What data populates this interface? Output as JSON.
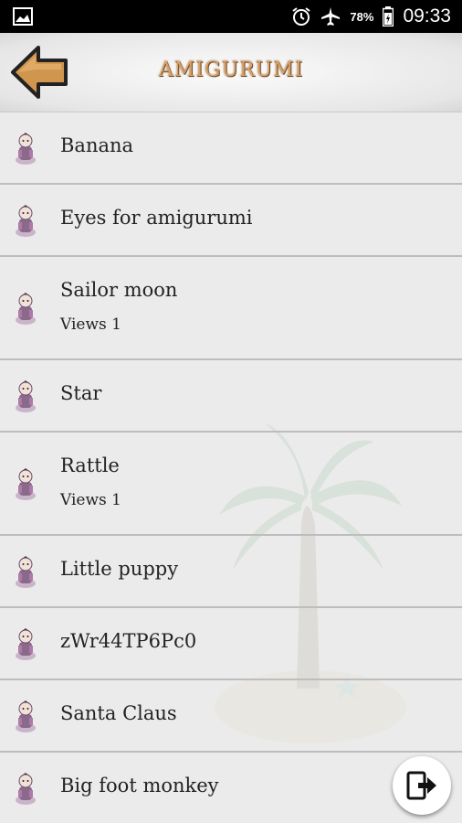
{
  "status_bar": {
    "battery": "78%",
    "time": "09:33",
    "icons": [
      "gallery-icon",
      "alarm-icon",
      "airplane-mode-icon",
      "battery-icon"
    ]
  },
  "header": {
    "title": "AMIGURUMI",
    "back_icon": "back-arrow-icon"
  },
  "items": [
    {
      "title": "Banana",
      "subtitle": ""
    },
    {
      "title": "Eyes for amigurumi",
      "subtitle": ""
    },
    {
      "title": "Sailor moon",
      "subtitle": "Views 1"
    },
    {
      "title": "Star",
      "subtitle": ""
    },
    {
      "title": "Rattle",
      "subtitle": "Views 1"
    },
    {
      "title": "Little puppy",
      "subtitle": ""
    },
    {
      "title": "zWr44TP6Pc0",
      "subtitle": ""
    },
    {
      "title": "Santa Claus",
      "subtitle": ""
    },
    {
      "title": "Big foot monkey",
      "subtitle": ""
    }
  ],
  "fab": {
    "icon": "exit-icon"
  },
  "colors": {
    "title_text": "#d9a066",
    "back_arrow": "#c98f48",
    "divider": "#bdbdbd"
  }
}
